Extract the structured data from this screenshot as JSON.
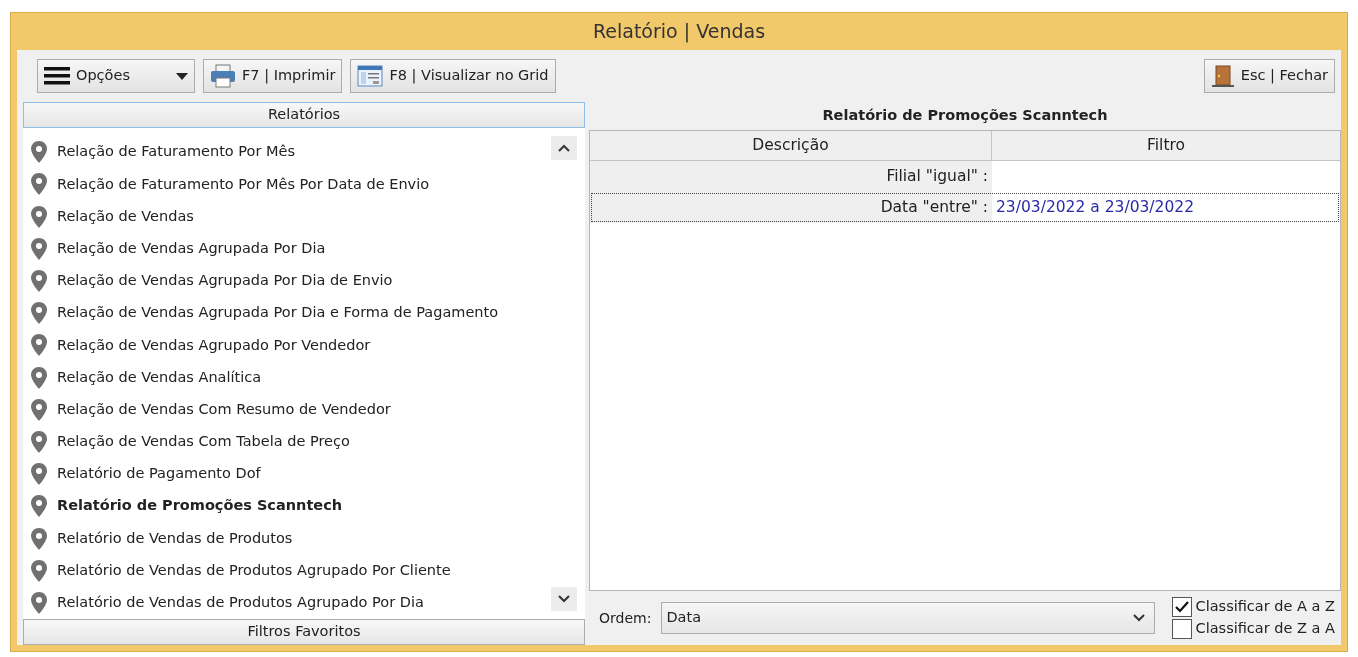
{
  "window": {
    "title": "Relatório | Vendas"
  },
  "toolbar": {
    "buttons": [
      {
        "kind": "menu",
        "label": "Opções"
      },
      {
        "kind": "print",
        "label": "F7 | Imprimir"
      },
      {
        "kind": "grid",
        "label": "F8 | Visualizar no Grid"
      }
    ],
    "close": {
      "label": "Esc | Fechar"
    }
  },
  "left_panel": {
    "header": "Relatórios",
    "footer": "Filtros Favoritos",
    "items": [
      {
        "label": "Relação de Faturamento Por Mês",
        "selected": false
      },
      {
        "label": "Relação de Faturamento Por Mês Por Data de Envio",
        "selected": false
      },
      {
        "label": "Relação de Vendas",
        "selected": false
      },
      {
        "label": "Relação de Vendas Agrupada Por Dia",
        "selected": false
      },
      {
        "label": "Relação de Vendas Agrupada Por Dia de Envio",
        "selected": false
      },
      {
        "label": "Relação de Vendas Agrupada Por Dia e Forma de Pagamento",
        "selected": false
      },
      {
        "label": "Relação de Vendas Agrupado Por Vendedor",
        "selected": false
      },
      {
        "label": "Relação de Vendas Analítica",
        "selected": false
      },
      {
        "label": "Relação de Vendas Com Resumo de Vendedor",
        "selected": false
      },
      {
        "label": "Relação de Vendas Com Tabela de Preço",
        "selected": false
      },
      {
        "label": "Relatório de Pagamento Dof",
        "selected": false
      },
      {
        "label": "Relatório de Promoções Scanntech",
        "selected": true
      },
      {
        "label": "Relatório de Vendas de Produtos",
        "selected": false
      },
      {
        "label": "Relatório de Vendas de Produtos Agrupado Por Cliente",
        "selected": false
      },
      {
        "label": "Relatório de Vendas de Produtos Agrupado Por Dia",
        "selected": false
      }
    ]
  },
  "right_panel": {
    "title": "Relatório de Promoções Scanntech",
    "table": {
      "columns": [
        "Descrição",
        "Filtro"
      ],
      "rows": [
        {
          "descricao": "Filial \"igual\" :",
          "filtro": "",
          "selected": false
        },
        {
          "descricao": "Data \"entre\" :",
          "filtro": "23/03/2022 a 23/03/2022",
          "selected": true
        }
      ]
    },
    "order": {
      "label": "Ordem:",
      "value": "Data"
    },
    "sort_options": [
      {
        "label": "Classificar de A a Z",
        "checked": true
      },
      {
        "label": "Classificar de Z a A",
        "checked": false
      }
    ]
  }
}
